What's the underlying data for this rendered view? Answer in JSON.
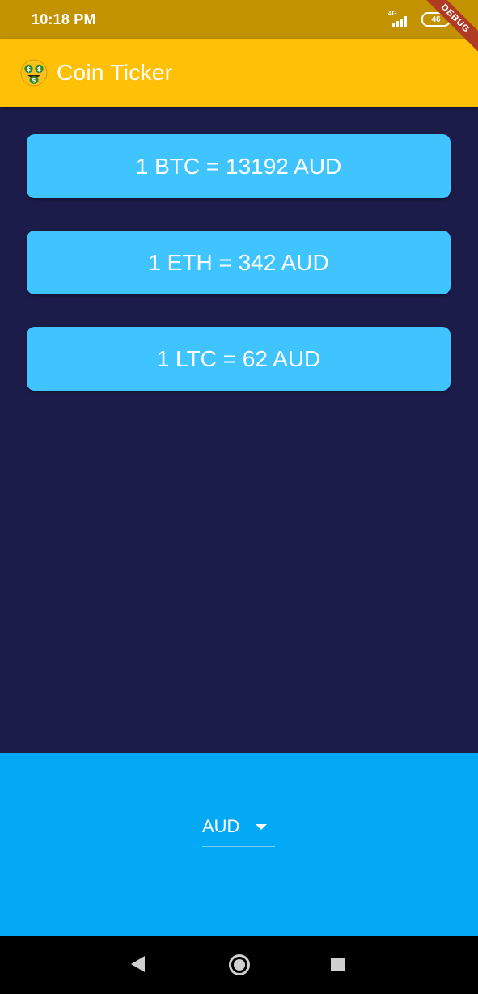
{
  "status_bar": {
    "time": "10:18 PM",
    "network_label": "4G",
    "battery": "46",
    "debug_banner": "DEBUG"
  },
  "app_bar": {
    "logo_icon": "money-mouth-face-icon",
    "title": "Coin Ticker"
  },
  "rates": [
    {
      "label": "1 BTC = 13192 AUD"
    },
    {
      "label": "1 ETH = 342 AUD"
    },
    {
      "label": "1 LTC = 62 AUD"
    }
  ],
  "picker": {
    "selected_currency": "AUD",
    "arrow_icon": "arrow-drop-down-icon"
  },
  "nav_bar": {
    "back_icon": "back-triangle-icon",
    "home_icon": "home-circle-icon",
    "recents_icon": "recents-square-icon"
  },
  "colors": {
    "status_bar": "#c29200",
    "app_bar": "#ffc107",
    "background": "#1c1c4a",
    "card": "#40c4ff",
    "picker_area": "#03a9f4",
    "nav_bar": "#000000"
  }
}
